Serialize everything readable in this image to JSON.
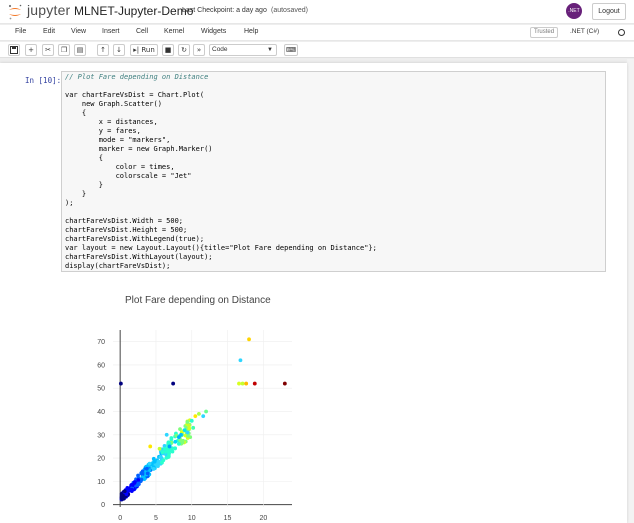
{
  "header": {
    "logo_text": "jupyter",
    "notebook_name": "MLNET-Jupyter-Demo",
    "checkpoint": "Last Checkpoint: a day ago",
    "autosave": "(autosaved)",
    "kernel_badge": ".NET",
    "logout_label": "Logout"
  },
  "menubar": {
    "items": [
      "File",
      "Edit",
      "View",
      "Insert",
      "Cell",
      "Kernel",
      "Widgets",
      "Help"
    ],
    "trusted": "Trusted",
    "kernel_name": ".NET (C#)"
  },
  "toolbar": {
    "run_label": "Run",
    "cell_type": "Code"
  },
  "cell": {
    "prompt": "In [10]:",
    "code_lines": [
      "// Plot Fare depending on Distance",
      "",
      "var chartFareVsDist = Chart.Plot(",
      "    new Graph.Scatter()",
      "    {",
      "        x = distances,",
      "        y = fares,",
      "        mode = \"markers\",",
      "        marker = new Graph.Marker()",
      "        {",
      "            color = times,",
      "            colorscale = \"Jet\"",
      "        }",
      "    }",
      ");",
      "",
      "chartFareVsDist.Width = 500;",
      "chartFareVsDist.Height = 500;",
      "chartFareVsDist.WithLegend(true);",
      "var layout = new Layout.Layout(){title=\"Plot Fare depending on Distance\"};",
      "chartFareVsDist.WithLayout(layout);",
      "display(chartFareVsDist);"
    ]
  },
  "chart_data": {
    "type": "scatter",
    "title": "Plot Fare depending on Distance",
    "xlabel": "",
    "ylabel": "",
    "xlim": [
      -1,
      24
    ],
    "ylim": [
      -1,
      75
    ],
    "xticks": [
      0,
      5,
      10,
      15,
      20
    ],
    "yticks": [
      0,
      10,
      20,
      30,
      40,
      50,
      60,
      70
    ],
    "colorscale": "Jet",
    "grid": true,
    "points": [
      {
        "x": 0.1,
        "y": 52,
        "c": "#00007f"
      },
      {
        "x": 7.4,
        "y": 52,
        "c": "#00007f"
      },
      {
        "x": 16.8,
        "y": 62,
        "c": "#2ed6ff"
      },
      {
        "x": 18.0,
        "y": 71,
        "c": "#ffd400"
      },
      {
        "x": 16.6,
        "y": 52,
        "c": "#d7ff1f"
      },
      {
        "x": 17.1,
        "y": 52,
        "c": "#c6ff30"
      },
      {
        "x": 17.6,
        "y": 52,
        "c": "#ffb900"
      },
      {
        "x": 18.8,
        "y": 52,
        "c": "#c00000"
      },
      {
        "x": 23.0,
        "y": 52,
        "c": "#7f0000"
      },
      {
        "x": 12.0,
        "y": 40,
        "c": "#69ff8e"
      },
      {
        "x": 11.0,
        "y": 39,
        "c": "#a8ff4e"
      },
      {
        "x": 10.5,
        "y": 38,
        "c": "#ffe800"
      },
      {
        "x": 11.6,
        "y": 38,
        "c": "#2ed6ff"
      },
      {
        "x": 10.0,
        "y": 36,
        "c": "#29ffce"
      },
      {
        "x": 9.6,
        "y": 34,
        "c": "#c6ff30"
      },
      {
        "x": 10.2,
        "y": 33,
        "c": "#47ffae"
      },
      {
        "x": 9.0,
        "y": 32,
        "c": "#00e4f8"
      },
      {
        "x": 9.4,
        "y": 31,
        "c": "#2ed6ff"
      },
      {
        "x": 8.5,
        "y": 30,
        "c": "#00c0ff"
      },
      {
        "x": 6.5,
        "y": 30,
        "c": "#2ed6ff"
      },
      {
        "x": 4.2,
        "y": 25,
        "c": "#ffe800"
      },
      {
        "x": 5.5,
        "y": 24,
        "c": "#c6ff30"
      },
      {
        "x": 7.7,
        "y": 27,
        "c": "#00d4ff"
      },
      {
        "x": 8.2,
        "y": 29,
        "c": "#00b0ff"
      },
      {
        "x": 6.9,
        "y": 25,
        "c": "#00a0ff"
      }
    ],
    "trend": {
      "slope": 3.15,
      "intercept": 2.5,
      "x_from": 0.2,
      "x_to": 9.8
    }
  }
}
